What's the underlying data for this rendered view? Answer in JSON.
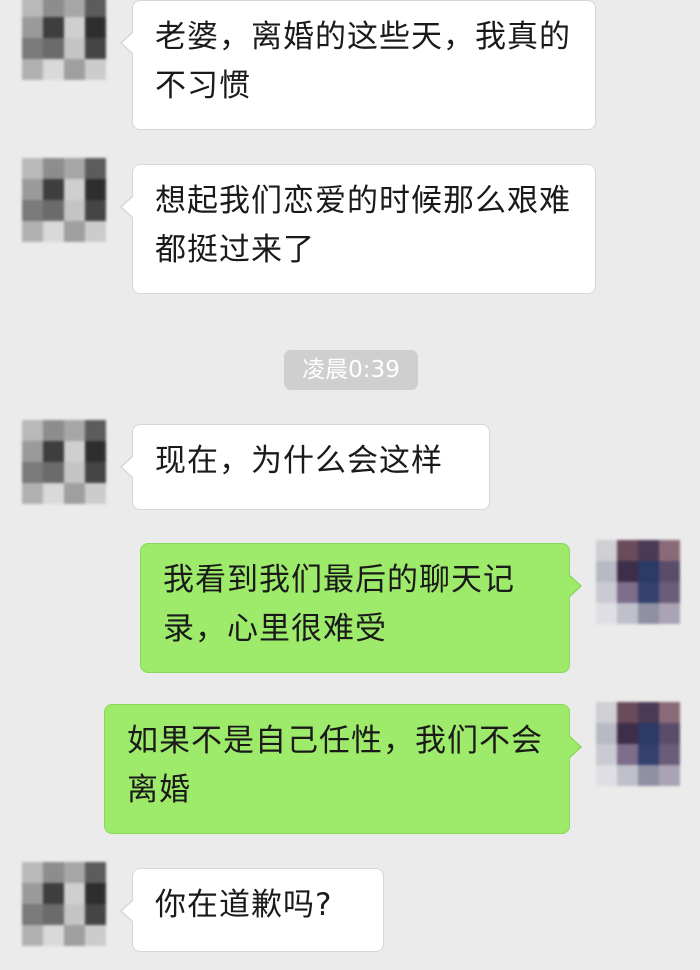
{
  "conversation": {
    "timestamp": "凌晨0:39",
    "messages": [
      {
        "side": "in",
        "text": "老婆，离婚的这些天，我真的不习惯"
      },
      {
        "side": "in",
        "text": "想起我们恋爱的时候那么艰难都挺过来了"
      },
      {
        "side": "in",
        "text": "现在，为什么会这样"
      },
      {
        "side": "out",
        "text": "我看到我们最后的聊天记录，心里很难受"
      },
      {
        "side": "out",
        "text": "如果不是自己任性，我们不会离婚"
      },
      {
        "side": "in",
        "text": "你在道歉吗?"
      }
    ]
  },
  "colors": {
    "background": "#ebebeb",
    "incoming_bubble": "#ffffff",
    "outgoing_bubble": "#9eea6a",
    "timestamp_bg": "#cfcfcf"
  },
  "icons": {
    "contact_avatar": "contact-avatar-icon",
    "user_avatar": "user-avatar-icon"
  }
}
